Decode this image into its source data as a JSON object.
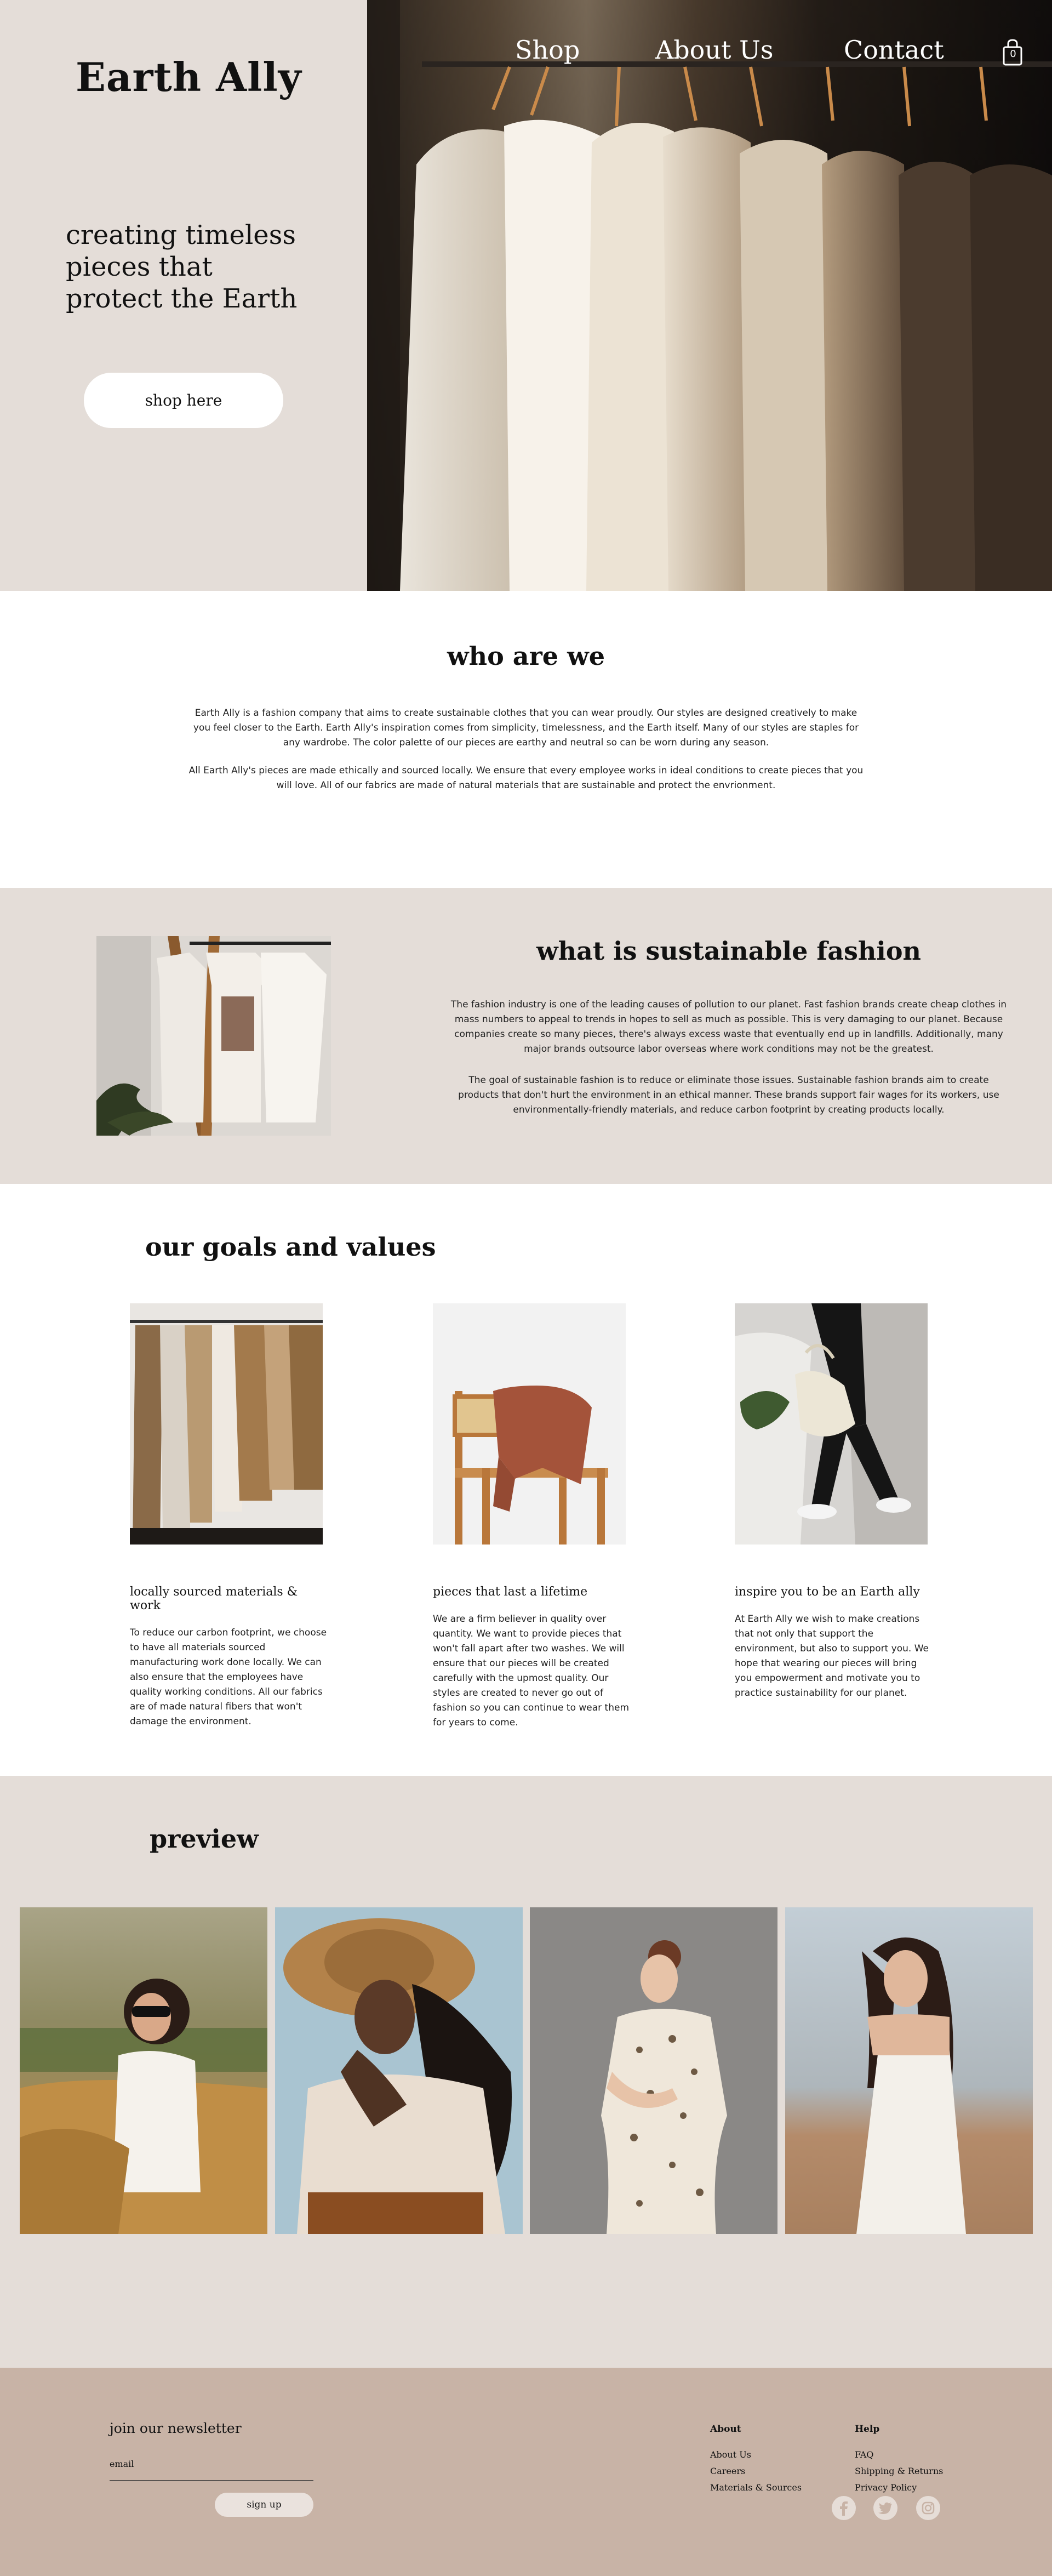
{
  "brand": {
    "name": "Earth Ally"
  },
  "nav": {
    "items": [
      "Shop",
      "About Us",
      "Contact"
    ],
    "cart_count": "0"
  },
  "hero": {
    "tagline": "creating timeless pieces that protect the Earth",
    "cta_label": "shop here"
  },
  "who": {
    "heading": "who are we",
    "paragraphs": [
      "Earth Ally is a fashion company that aims to create sustainable clothes that you can wear proudly. Our styles are designed creatively to make you feel closer to the Earth. Earth Ally's inspiration comes from simplicity, timelessness, and the Earth itself. Many of our styles are staples for any wardrobe. The color palette of our pieces are earthy and neutral so can be worn during any season.",
      "All Earth Ally's pieces are made ethically and sourced locally. We ensure that every employee works in ideal conditions to create pieces that you will love. All of our fabrics are made of natural materials that are sustainable and protect the envrionment."
    ]
  },
  "sustainable": {
    "heading": "what is sustainable fashion",
    "paragraphs": [
      "The fashion industry is one of the leading causes of pollution to our planet. Fast fashion brands create cheap clothes in mass numbers to appeal to trends in hopes to sell as much as possible. This is very damaging to our planet. Because companies create so many pieces, there's always excess waste that eventually end up in landfills. Additionally, many major brands outsource labor overseas where work conditions may not be the greatest.",
      "The goal of sustainable fashion is to reduce or eliminate those issues. Sustainable fashion brands aim to create products that don't hurt the environment in an ethical manner. These brands support fair wages for its workers, use environmentally-friendly materials, and reduce carbon footprint by creating products locally."
    ]
  },
  "goals": {
    "heading": "our goals and values",
    "cards": [
      {
        "title": "locally sourced materials & work",
        "text": "To reduce our carbon footprint, we choose to have all materials sourced manufacturing work done locally. We can also ensure that the employees have quality working conditions. All our fabrics are of made natural fibers that won't damage the environment."
      },
      {
        "title": "pieces that last a lifetime",
        "text": "We are a firm believer in quality over quantity. We want to provide pieces that won't fall apart after two washes. We will ensure that our pieces will be created carefully with the upmost quality. Our styles are created to never go out of fashion so you can continue to wear them for years to come."
      },
      {
        "title": "inspire you to be an Earth ally",
        "text": "At Earth Ally we wish to make creations that not only that support the environment, but also to support you. We hope that wearing our pieces will bring you empowerment and motivate you to practice sustainability for our planet."
      }
    ]
  },
  "preview": {
    "heading": "preview"
  },
  "footer": {
    "newsletter_title": "join our newsletter",
    "email_label": "email",
    "signup_label": "sign up",
    "about": {
      "heading": "About",
      "links": [
        "About Us",
        "Careers",
        "Materials & Sources"
      ]
    },
    "help": {
      "heading": "Help",
      "links": [
        "FAQ",
        "Shipping & Returns",
        "Privacy Policy"
      ]
    },
    "social_icons": [
      "facebook-icon",
      "twitter-icon",
      "instagram-icon"
    ]
  },
  "colors": {
    "beige": "#e4ddd8",
    "footer": "#c8b3a6",
    "white": "#ffffff"
  }
}
